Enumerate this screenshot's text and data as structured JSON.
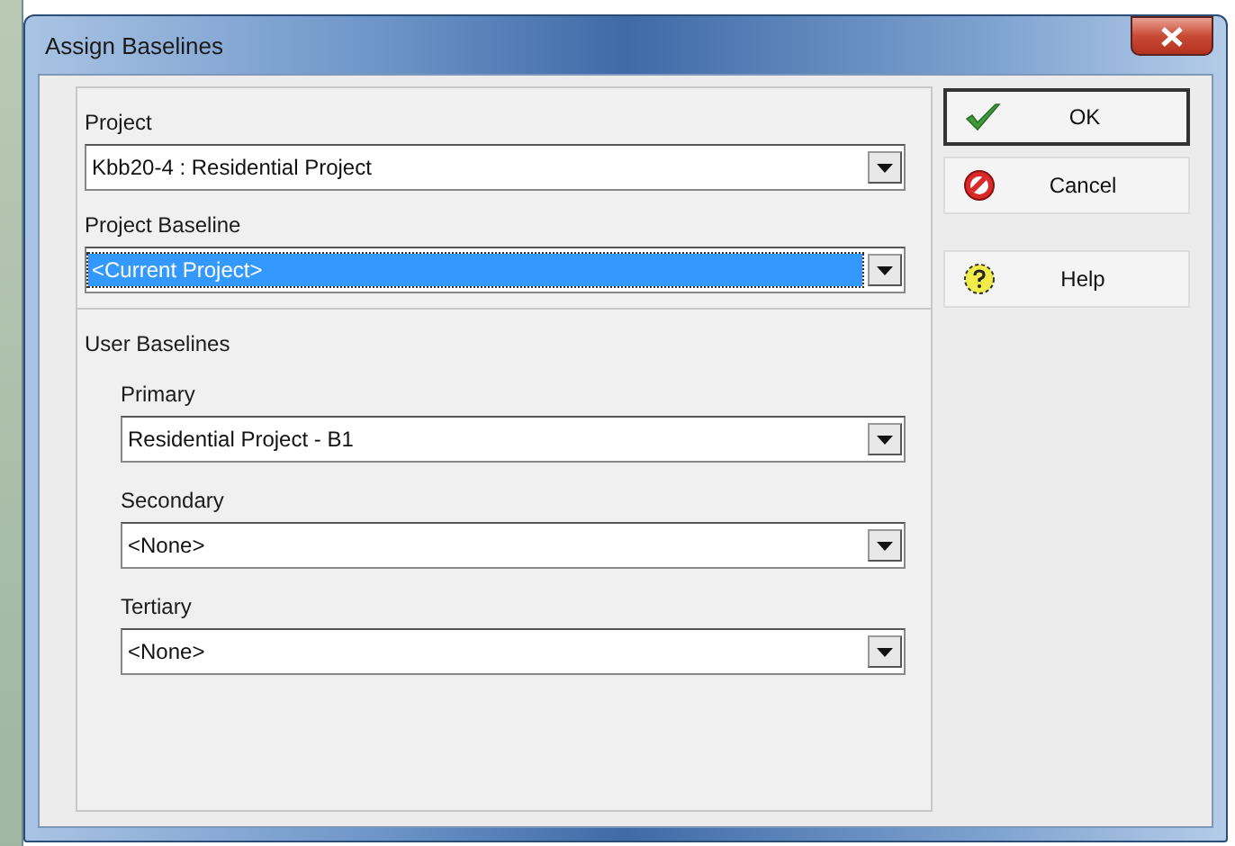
{
  "window": {
    "title": "Assign Baselines"
  },
  "project_fields": [
    {
      "label": "Project",
      "value": "Kbb20-4 : Residential Project",
      "focused": false
    },
    {
      "label": "Project Baseline",
      "value": "<Current Project>",
      "focused": true
    }
  ],
  "user_baselines": {
    "title": "User Baselines",
    "fields": [
      {
        "label": "Primary",
        "value": "Residential Project - B1",
        "focused": false
      },
      {
        "label": "Secondary",
        "value": "<None>",
        "focused": false
      },
      {
        "label": "Tertiary",
        "value": "<None>",
        "focused": false
      }
    ]
  },
  "buttons": [
    {
      "label": "OK",
      "kind": "ok",
      "default": true
    },
    {
      "label": "Cancel",
      "kind": "cancel",
      "default": false
    },
    {
      "label": "Help",
      "kind": "help",
      "default": false
    }
  ]
}
